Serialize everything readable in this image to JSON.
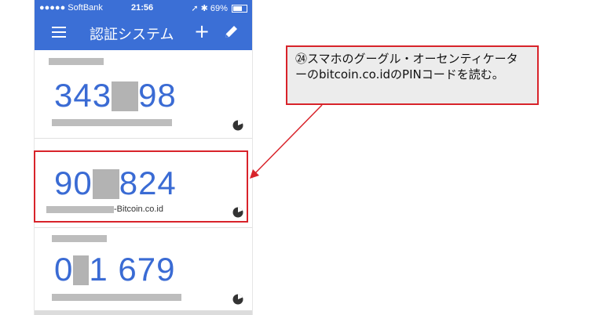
{
  "status_bar": {
    "carrier": "●●●●● SoftBank",
    "time": "21:56",
    "battery": "69%",
    "battery_level": 0.69
  },
  "app_bar": {
    "title": "認証システム",
    "menu_icon": "menu-icon",
    "add_icon": "+",
    "edit_icon": "pencil-icon"
  },
  "entries": [
    {
      "code_left": "343",
      "code_right": "98",
      "label": ""
    },
    {
      "code_left": "90",
      "code_right": "824",
      "label": "-Bitcoin.co.id"
    },
    {
      "code_left": "0",
      "code_right": "1 679",
      "label": ""
    }
  ],
  "annotation": {
    "text": "㉔スマホのグーグル・オーセンティケーターのbitcoin.co.idのPINコードを読む。"
  },
  "colors": {
    "accent": "#3b6fd6",
    "code": "#3a6bd4",
    "annotation_border": "#d8232a",
    "annotation_bg": "#ececec"
  }
}
